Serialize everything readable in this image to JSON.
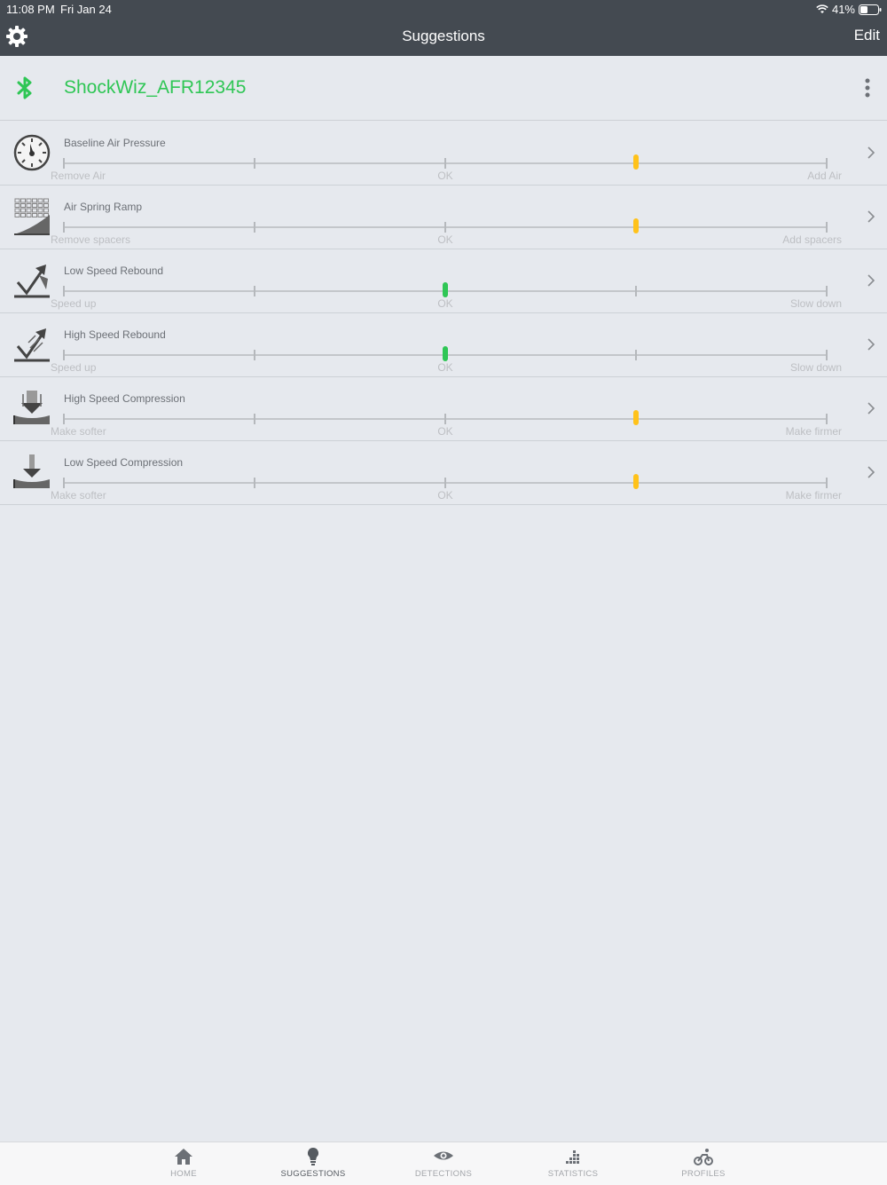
{
  "status_bar": {
    "time": "11:08 PM",
    "date": "Fri Jan 24",
    "battery": "41%"
  },
  "nav": {
    "title": "Suggestions",
    "edit_label": "Edit"
  },
  "device": {
    "name": "ShockWiz_AFR12345",
    "name_color": "#2fc655"
  },
  "colors": {
    "ok": "#2fc655",
    "warn": "#ffc21a"
  },
  "suggestions": [
    {
      "label": "Baseline Air Pressure",
      "left": "Remove Air",
      "mid": "OK",
      "right": "Add Air",
      "level": 0.75,
      "status": "warn",
      "icon": "pressure-gauge-icon"
    },
    {
      "label": "Air Spring Ramp",
      "left": "Remove spacers",
      "mid": "OK",
      "right": "Add spacers",
      "level": 0.75,
      "status": "warn",
      "icon": "spring-ramp-icon"
    },
    {
      "label": "Low Speed Rebound",
      "left": "Speed up",
      "mid": "OK",
      "right": "Slow down",
      "level": 0.5,
      "status": "ok",
      "icon": "low-speed-rebound-icon"
    },
    {
      "label": "High Speed Rebound",
      "left": "Speed up",
      "mid": "OK",
      "right": "Slow down",
      "level": 0.5,
      "status": "ok",
      "icon": "high-speed-rebound-icon"
    },
    {
      "label": "High Speed Compression",
      "left": "Make softer",
      "mid": "OK",
      "right": "Make firmer",
      "level": 0.75,
      "status": "warn",
      "icon": "high-speed-compression-icon"
    },
    {
      "label": "Low Speed Compression",
      "left": "Make softer",
      "mid": "OK",
      "right": "Make firmer",
      "level": 0.75,
      "status": "warn",
      "icon": "low-speed-compression-icon"
    }
  ],
  "tabs": [
    {
      "label": "HOME",
      "icon": "home-icon"
    },
    {
      "label": "SUGGESTIONS",
      "icon": "lightbulb-icon",
      "active": true
    },
    {
      "label": "DETECTIONS",
      "icon": "eye-icon"
    },
    {
      "label": "STATISTICS",
      "icon": "bar-chart-icon"
    },
    {
      "label": "PROFILES",
      "icon": "bike-rider-icon"
    }
  ]
}
